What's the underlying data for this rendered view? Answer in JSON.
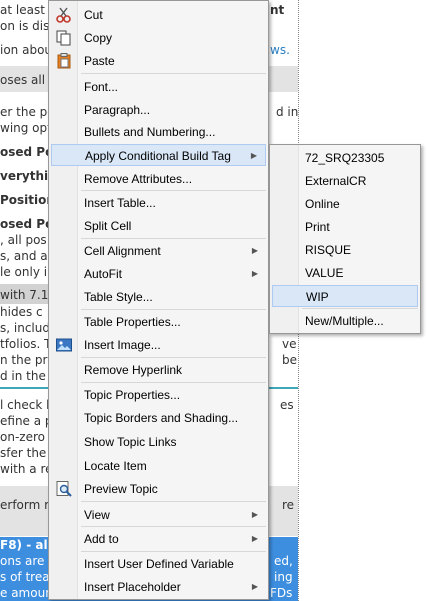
{
  "background_doc": {
    "lines": [
      "at least o",
      "on is disa",
      "ion abou",
      "oses all p",
      "er the po",
      "wing opti",
      "osed Pos",
      "verything",
      " Position",
      "osed Pos",
      ", all pos",
      "s, and all",
      "le only in",
      "with 7.1.",
      " hides c",
      "s, includi",
      "tfolios. T",
      "n the pre",
      "d in the li",
      "l check b",
      "efine a p",
      "on-zero n",
      "sfer the",
      "with a re",
      "erform re",
      "F8) - all",
      "ons are p",
      "s of treas",
      "e amoun"
    ],
    "right_fragments": {
      "r1": "nt",
      "r2": "ws.",
      "r3": "d in",
      "r4": "ve",
      "r5": "be",
      "r6": "es",
      "r7": "re",
      "r8": "ed,",
      "r9": "ing",
      "r10": "FDs"
    }
  },
  "context_menu": {
    "items": [
      {
        "label": "Cut",
        "icon": "scissors-icon"
      },
      {
        "label": "Copy",
        "icon": "copy-icon"
      },
      {
        "label": "Paste",
        "icon": "paste-icon"
      },
      {
        "label": "Font..."
      },
      {
        "label": "Paragraph..."
      },
      {
        "label": "Bullets and Numbering..."
      },
      {
        "label": "Apply Conditional Build Tag",
        "submenu": true,
        "highlighted": true
      },
      {
        "label": "Remove Attributes..."
      },
      {
        "label": "Insert Table..."
      },
      {
        "label": "Split Cell"
      },
      {
        "label": "Cell Alignment",
        "submenu": true
      },
      {
        "label": "AutoFit",
        "submenu": true
      },
      {
        "label": "Table Style..."
      },
      {
        "label": "Table Properties..."
      },
      {
        "label": "Insert Image...",
        "icon": "image-icon"
      },
      {
        "label": "Remove Hyperlink"
      },
      {
        "label": "Topic Properties..."
      },
      {
        "label": "Topic Borders and Shading..."
      },
      {
        "label": "Show Topic Links"
      },
      {
        "label": "Locate Item"
      },
      {
        "label": "Preview Topic",
        "icon": "preview-icon"
      },
      {
        "label": "View",
        "submenu": true
      },
      {
        "label": "Add to",
        "submenu": true
      },
      {
        "label": "Insert User Defined Variable"
      },
      {
        "label": "Insert Placeholder",
        "submenu": true
      }
    ]
  },
  "submenu": {
    "items": [
      {
        "label": "72_SRQ23305"
      },
      {
        "label": "ExternalCR"
      },
      {
        "label": "Online"
      },
      {
        "label": "Print"
      },
      {
        "label": "RISQUE"
      },
      {
        "label": "VALUE"
      },
      {
        "label": "WIP",
        "highlighted": true
      },
      {
        "label": "New/Multiple..."
      }
    ]
  },
  "colors": {
    "highlight_bg": "#d9e7f7",
    "highlight_border": "#aecaf0",
    "menu_bg": "#f5f5f5",
    "selection_blue": "#3e8ee0"
  }
}
